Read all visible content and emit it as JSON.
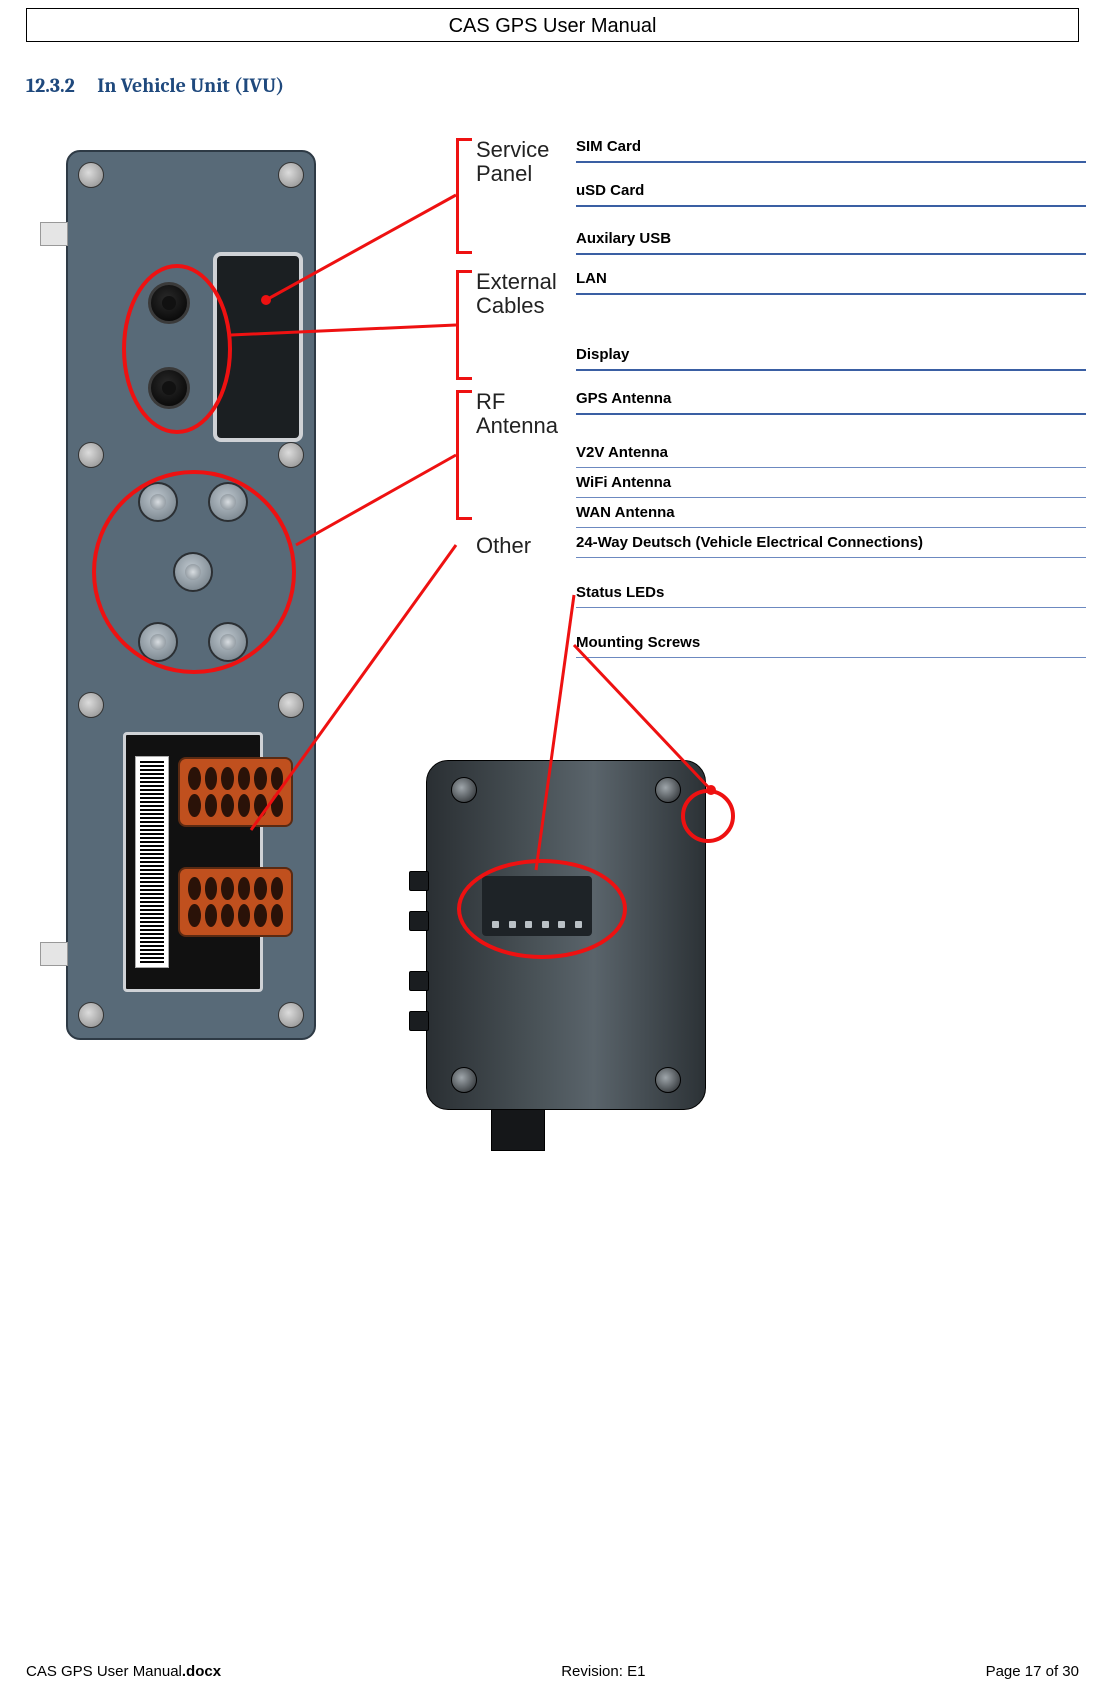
{
  "header_title": "CAS GPS User Manual",
  "section_number": "12.3.2",
  "section_title": "In Vehicle Unit (IVU)",
  "groups": {
    "service_panel": {
      "title": "Service Panel",
      "items": [
        "SIM Card",
        "uSD Card",
        "Auxilary USB"
      ]
    },
    "external_cables": {
      "title": "External Cables",
      "items": [
        "LAN",
        "Display"
      ]
    },
    "rf_antenna": {
      "title": "RF Antenna",
      "items": [
        "GPS Antenna",
        "V2V Antenna",
        "WiFi Antenna",
        "WAN Antenna"
      ]
    },
    "other": {
      "title": "Other",
      "items": [
        "24-Way Deutsch (Vehicle Electrical Connections)",
        "Status LEDs",
        "Mounting Screws"
      ]
    }
  },
  "footer": {
    "filename_base": "CAS GPS User Manual",
    "filename_ext": ".docx",
    "revision": "Revision: E1",
    "page": "Page 17 of 30"
  }
}
